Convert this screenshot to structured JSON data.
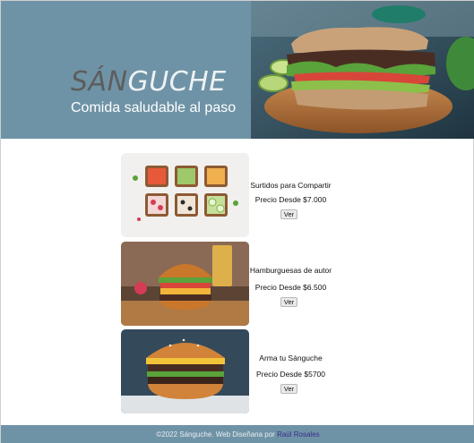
{
  "header": {
    "logo_part1": "SÁN",
    "logo_part2": "GUCHE",
    "tagline": "Comida saludable al paso"
  },
  "products": [
    {
      "name": "Surtidos para Compartir",
      "price": "Precio Desde $7.000",
      "button": "Ver"
    },
    {
      "name": "Hamburguesas de autor",
      "price": "Precio Desde $6.500",
      "button": "Ver"
    },
    {
      "name": "Arma tu Sánguche",
      "price": "Precio Desde $5700",
      "button": "Ver"
    }
  ],
  "footer": {
    "text": "©2022 Sánguche. Web Diseñana por",
    "author": "Raúl Rosales"
  },
  "colors": {
    "header_bg": "#6f93a6",
    "footer_bg": "#6f93a6",
    "author_link": "#3b2c8c"
  }
}
